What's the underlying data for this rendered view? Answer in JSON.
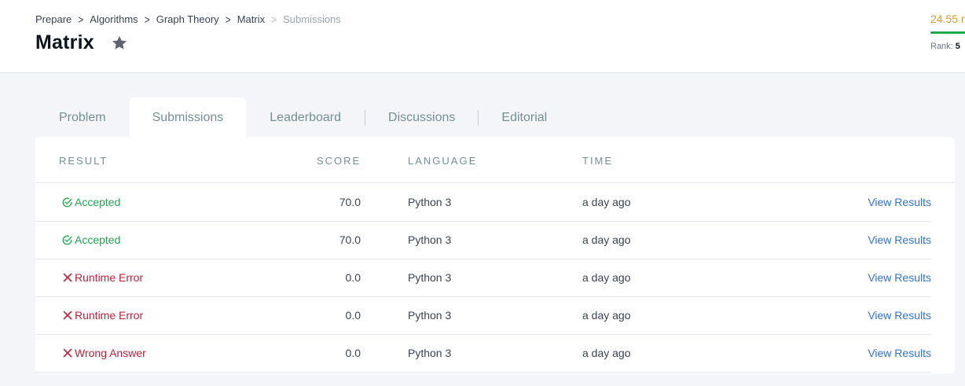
{
  "breadcrumb": [
    "Prepare",
    "Algorithms",
    "Graph Theory",
    "Matrix",
    "Submissions"
  ],
  "page_title": "Matrix",
  "stats": {
    "points": "24.55 r",
    "rank_label": "Rank:",
    "rank_value": "5"
  },
  "tabs": [
    "Problem",
    "Submissions",
    "Leaderboard",
    "Discussions",
    "Editorial"
  ],
  "active_tab": "Submissions",
  "table": {
    "headers": [
      "RESULT",
      "SCORE",
      "LANGUAGE",
      "TIME"
    ],
    "rows": [
      {
        "result": "Accepted",
        "status": "accepted",
        "score": "70.0",
        "language": "Python 3",
        "time": "a day ago",
        "action": "View Results"
      },
      {
        "result": "Accepted",
        "status": "accepted",
        "score": "70.0",
        "language": "Python 3",
        "time": "a day ago",
        "action": "View Results"
      },
      {
        "result": "Runtime Error",
        "status": "error",
        "score": "0.0",
        "language": "Python 3",
        "time": "a day ago",
        "action": "View Results"
      },
      {
        "result": "Runtime Error",
        "status": "error",
        "score": "0.0",
        "language": "Python 3",
        "time": "a day ago",
        "action": "View Results"
      },
      {
        "result": "Wrong Answer",
        "status": "error",
        "score": "0.0",
        "language": "Python 3",
        "time": "a day ago",
        "action": "View Results"
      }
    ]
  },
  "colors": {
    "accepted": "#1ba94c",
    "error": "#c0203b",
    "link": "#2f71d9",
    "points": "#d99a2b"
  },
  "icons": {
    "star": "star-icon",
    "chevron": "chevron-right-icon",
    "accepted": "check-circle-icon",
    "error": "cross-icon"
  }
}
